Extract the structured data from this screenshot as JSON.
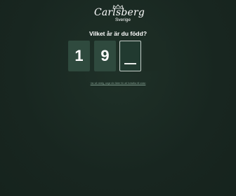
{
  "brand": {
    "name": "Carlsberg",
    "subtitle": "Sverige"
  },
  "age_gate": {
    "question": "Vilket år är du född?",
    "digits": [
      "1",
      "9",
      "",
      ""
    ],
    "footer_link": "Var så vänlig, ange din ålder för att fortsätta till sidan"
  },
  "colors": {
    "background": "#182620",
    "digit_box": "#2f4a3e",
    "text": "#ffffff"
  }
}
